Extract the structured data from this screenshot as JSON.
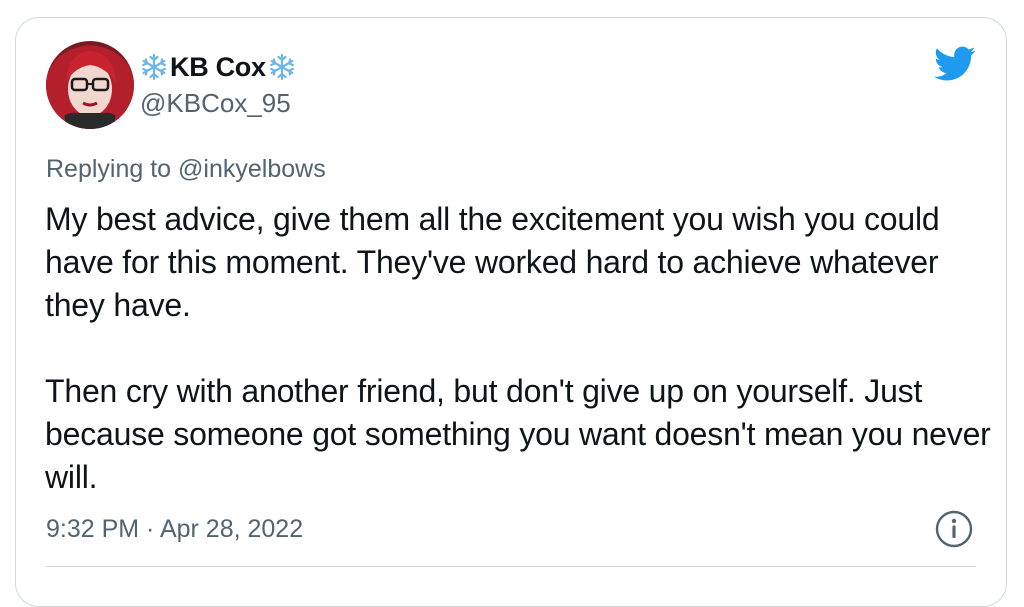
{
  "author": {
    "display_name": "KB Cox",
    "name_decoration_icon": "snowflake-emoji",
    "handle": "@KBCox_95",
    "avatar_icon": "profile-avatar"
  },
  "platform_icon": "twitter-bird-icon",
  "reply_context": {
    "prefix": "Replying to",
    "mention": "@inkyelbows"
  },
  "tweet": {
    "paragraphs": [
      "My best advice, give them all the excitement you wish you could have for this moment. They've worked hard to achieve whatever they have.",
      "Then cry with another friend, but don't give up on yourself. Just because someone got something you want doesn't mean you never will."
    ],
    "timestamp": "9:32 PM · Apr 28, 2022"
  },
  "info_icon": "info-icon",
  "colors": {
    "text": "#0f1419",
    "secondary_text": "#536471",
    "twitter_blue": "#1d9bf0",
    "border": "#cfd9de"
  }
}
